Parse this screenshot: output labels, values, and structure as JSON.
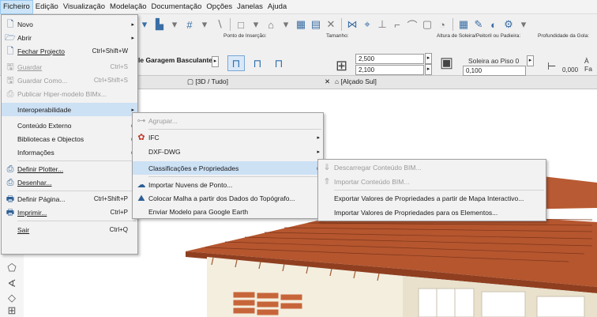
{
  "menubar": {
    "items": [
      "Ficheiro",
      "Edição",
      "Visualização",
      "Modelação",
      "Documentação",
      "Opções",
      "Janelas",
      "Ajuda"
    ]
  },
  "toolbar": {
    "insertion_point_label": "Ponto de Inserção:",
    "size_label": "Tamanho:",
    "sill_label": "Altura de Soleira/Peitoril ou Padieira:",
    "reveal_label": "Profundidade da Gola:",
    "door_type": "le Garagem Basculante",
    "width_value": "2,500",
    "height_value": "2,100",
    "sill_anchor": "Soleira ao Piso 0",
    "sill_value": "0,100",
    "reveal_value": "0,000",
    "face_label": "À Fa"
  },
  "tabs": {
    "tab3d": "[3D / Tudo]",
    "tab_elev": "[Alçado Sul]"
  },
  "file_menu": {
    "items": [
      {
        "label": "Novo",
        "shortcut": "",
        "submenu": true,
        "icon": "new-doc-icon"
      },
      {
        "label": "Abrir",
        "shortcut": "",
        "submenu": true,
        "icon": "open-folder-icon"
      },
      {
        "label": "Fechar Projecto",
        "shortcut": "Ctrl+Shift+W",
        "submenu": false,
        "icon": "close-project-icon"
      },
      {
        "label": "Guardar",
        "shortcut": "Ctrl+S",
        "submenu": false,
        "icon": "save-icon",
        "disabled": true
      },
      {
        "label": "Guardar Como...",
        "shortcut": "Ctrl+Shift+S",
        "submenu": false,
        "icon": "save-as-icon",
        "disabled": true
      },
      {
        "label": "Publicar Hiper-modelo BIMx...",
        "shortcut": "",
        "submenu": false,
        "icon": "publish-bimx-icon",
        "disabled": true
      },
      {
        "label": "Interoperabilidade",
        "shortcut": "",
        "submenu": true,
        "icon": "",
        "highlighted": true
      },
      {
        "label": "Conteúdo Externo",
        "shortcut": "",
        "submenu": true
      },
      {
        "label": "Bibliotecas e Objectos",
        "shortcut": "",
        "submenu": true
      },
      {
        "label": "Informações",
        "shortcut": "",
        "submenu": true
      },
      {
        "label": "Definir Plotter...",
        "shortcut": "",
        "submenu": false,
        "icon": "plotter-setup-icon"
      },
      {
        "label": "Desenhar...",
        "shortcut": "",
        "submenu": false,
        "icon": "plot-icon"
      },
      {
        "label": "Definir Página...",
        "shortcut": "Ctrl+Shift+P",
        "submenu": false,
        "icon": "page-setup-icon"
      },
      {
        "label": "Imprimir...",
        "shortcut": "Ctrl+P",
        "submenu": false,
        "icon": "print-icon"
      },
      {
        "label": "Sair",
        "shortcut": "Ctrl+Q",
        "submenu": false
      }
    ]
  },
  "interop_menu": {
    "items": [
      {
        "label": "Agrupar...",
        "disabled": true
      },
      {
        "label": "IFC",
        "submenu": true
      },
      {
        "label": "DXF-DWG",
        "submenu": true
      },
      {
        "label": "Classificações e Propriedades",
        "submenu": true,
        "highlighted": true
      },
      {
        "label": "Importar Nuvens de Ponto..."
      },
      {
        "label": "Colocar Malha a partir dos Dados do Topógrafo..."
      },
      {
        "label": "Enviar Modelo para Google Earth"
      }
    ]
  },
  "class_menu": {
    "items": [
      {
        "label": "Descarregar Conteúdo BIM...",
        "disabled": true
      },
      {
        "label": "Importar Conteúdo BIM...",
        "disabled": true
      },
      {
        "label": "Exportar Valores de Propriedades a partir de Mapa Interactivo..."
      },
      {
        "label": "Importar Valores de Propriedades para os Elementos..."
      }
    ]
  },
  "colors": {
    "accent": "#cde1f5",
    "roof": "#b5562f",
    "wall": "#f4eedf",
    "brick": "#c7653a"
  }
}
